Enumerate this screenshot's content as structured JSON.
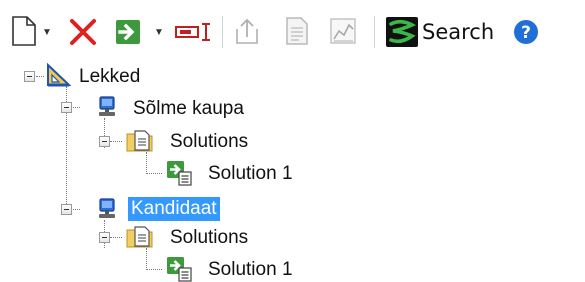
{
  "toolbar": {
    "buttons": [
      {
        "name": "new-document",
        "icon": "new-document-icon"
      },
      {
        "name": "delete",
        "icon": "red-x-icon"
      },
      {
        "name": "run",
        "icon": "green-arrow-icon"
      },
      {
        "name": "rename",
        "icon": "text-cursor-icon"
      },
      {
        "name": "export",
        "icon": "upload-icon"
      },
      {
        "name": "report",
        "icon": "document-icon"
      },
      {
        "name": "chart",
        "icon": "chart-icon"
      },
      {
        "name": "search",
        "icon": "search-logo-icon"
      },
      {
        "name": "help",
        "icon": "help-icon"
      }
    ],
    "search_label": "Search"
  },
  "colors": {
    "selection": "#3399ff",
    "delete_red": "#e02020",
    "run_green": "#3c9a3c",
    "help_blue": "#1f6fd6"
  },
  "tree": {
    "root": {
      "label": "Lekked",
      "icon": "triangle-ruler-icon"
    },
    "nodes": [
      {
        "label": "Sõlme kaupa",
        "icon": "computer-icon",
        "selected": false,
        "folder": {
          "label": "Solutions",
          "icon": "folder-document-icon"
        },
        "solution": {
          "label": "Solution 1",
          "icon": "solution-icon"
        }
      },
      {
        "label": "Kandidaat",
        "icon": "computer-icon",
        "selected": true,
        "folder": {
          "label": "Solutions",
          "icon": "folder-document-icon"
        },
        "solution": {
          "label": "Solution 1",
          "icon": "solution-icon"
        }
      }
    ]
  }
}
